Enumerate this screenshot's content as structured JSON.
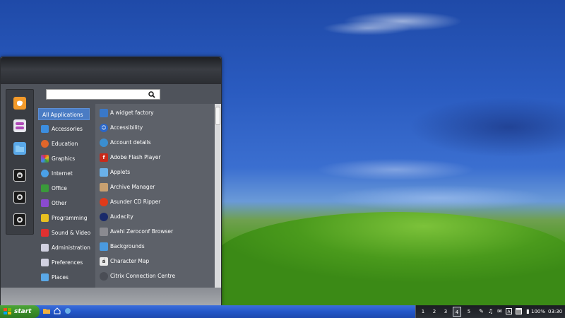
{
  "menu": {
    "search": {
      "value": "",
      "placeholder": ""
    },
    "favorites": [
      {
        "name": "firefox-icon",
        "color": "#f39a2a"
      },
      {
        "name": "settings-toggle-icon",
        "color": "#e8e8ee"
      },
      {
        "name": "folder-icon",
        "color": "#5aa8e8"
      },
      {
        "name": "lock-screen-icon",
        "color": "#2a2a2a"
      },
      {
        "name": "logout-icon",
        "color": "#2a2a2a"
      },
      {
        "name": "power-icon",
        "color": "#2a2a2a"
      }
    ],
    "categories": [
      {
        "label": "All Applications",
        "icon": "",
        "color": ""
      },
      {
        "label": "Accessories",
        "icon": "accessories-icon",
        "color": "#3c8ee0"
      },
      {
        "label": "Education",
        "icon": "education-icon",
        "color": "#e0662a"
      },
      {
        "label": "Graphics",
        "icon": "graphics-icon",
        "color": "#d63fa8"
      },
      {
        "label": "Internet",
        "icon": "internet-icon",
        "color": "#4aa0e8"
      },
      {
        "label": "Office",
        "icon": "office-icon",
        "color": "#3a9a3a"
      },
      {
        "label": "Other",
        "icon": "other-icon",
        "color": "#8a4ad0"
      },
      {
        "label": "Programming",
        "icon": "programming-icon",
        "color": "#e8c020"
      },
      {
        "label": "Sound & Video",
        "icon": "sound-video-icon",
        "color": "#e03030"
      },
      {
        "label": "Administration",
        "icon": "administration-icon",
        "color": "#d0d0e0"
      },
      {
        "label": "Preferences",
        "icon": "preferences-icon",
        "color": "#d0d0e0"
      },
      {
        "label": "Places",
        "icon": "places-icon",
        "color": "#5aa8e8"
      }
    ],
    "apps": [
      {
        "label": "A widget factory",
        "icon": "widget-factory-icon",
        "color": "#3a78c8"
      },
      {
        "label": "Accessibility",
        "icon": "accessibility-icon",
        "color": "#2a66c8"
      },
      {
        "label": "Account details",
        "icon": "account-icon",
        "color": "#3a8ed0"
      },
      {
        "label": "Adobe Flash Player",
        "icon": "flash-icon",
        "color": "#c82a1a"
      },
      {
        "label": "Applets",
        "icon": "applets-icon",
        "color": "#6ab0e8"
      },
      {
        "label": "Archive Manager",
        "icon": "archive-icon",
        "color": "#c8a070"
      },
      {
        "label": "Asunder CD Ripper",
        "icon": "cd-ripper-icon",
        "color": "#e03a1a"
      },
      {
        "label": "Audacity",
        "icon": "audacity-icon",
        "color": "#1a2a6a"
      },
      {
        "label": "Avahi Zeroconf Browser",
        "icon": "zeroconf-icon",
        "color": "#8a8a90"
      },
      {
        "label": "Backgrounds",
        "icon": "backgrounds-icon",
        "color": "#4a9ae0"
      },
      {
        "label": "Character Map",
        "icon": "character-map-icon",
        "color": "#e8e8e8"
      },
      {
        "label": "Citrix Connection Centre",
        "icon": "citrix-icon",
        "color": "#4a4d55"
      }
    ]
  },
  "taskbar": {
    "start_label": "start",
    "workspaces": [
      "1",
      "2",
      "3",
      "4",
      "5"
    ],
    "active_workspace": "4",
    "battery": "100%",
    "clock": "03:30",
    "tray_letter": "A"
  }
}
